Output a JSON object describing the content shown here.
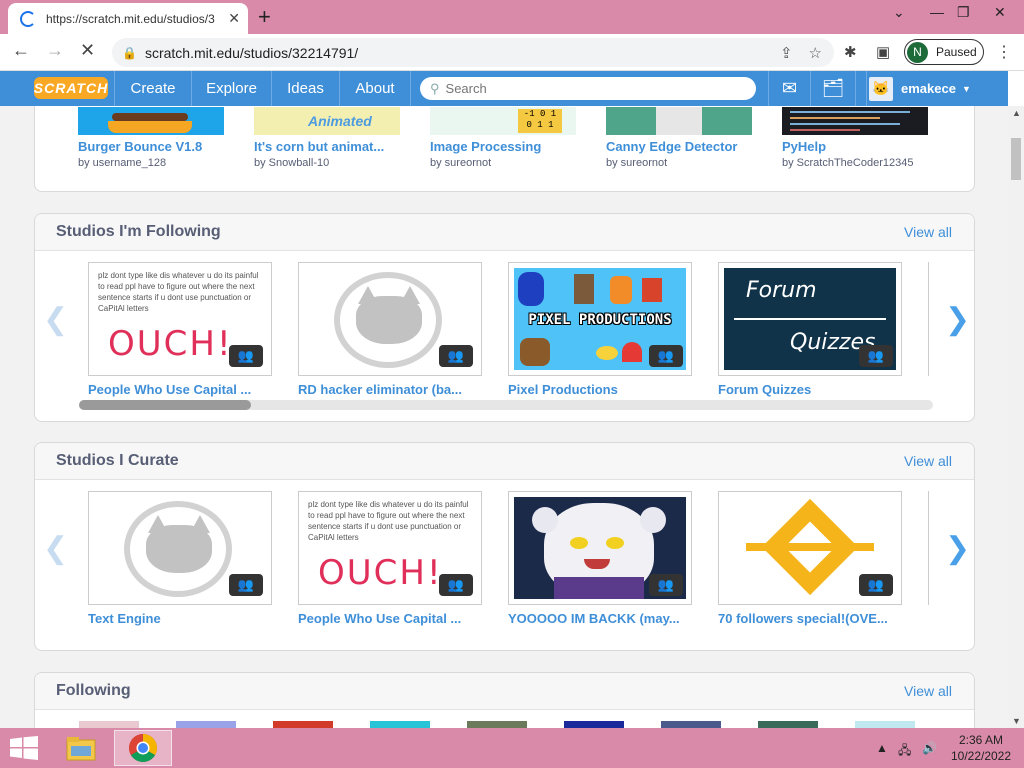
{
  "browser": {
    "tab_title": "https://scratch.mit.edu/studios/3",
    "new_tab": "+",
    "url": "scratch.mit.edu/studios/32214791/",
    "profile_initial": "N",
    "profile_status": "Paused"
  },
  "nav": {
    "logo": "SCRATCH",
    "links": [
      "Create",
      "Explore",
      "Ideas",
      "About"
    ],
    "search_placeholder": "Search",
    "username": "emakece"
  },
  "top_projects": [
    {
      "title": "Burger Bounce V1.8",
      "author": "by username_128"
    },
    {
      "title": "It's corn but animat...",
      "author": "by Snowball-10"
    },
    {
      "title": "Image Processing",
      "author": "by sureornot"
    },
    {
      "title": "Canny Edge Detector",
      "author": "by sureornot"
    },
    {
      "title": "PyHelp",
      "author": "by ScratchTheCoder12345"
    }
  ],
  "following_section": {
    "heading": "Studios I'm Following",
    "view_all": "View all",
    "studios": [
      {
        "title": "People Who Use Capital ...",
        "thumb_text": "plz dont type like dis whatever u do its painful to read ppl have to figure out where the next sentence starts if u dont use punctuation or CaPitAl letters",
        "thumb_big": "OUCH!"
      },
      {
        "title": "RD hacker eliminator (ba..."
      },
      {
        "title": "Pixel Productions",
        "thumb_big": "PIXEL PRODUCTIONS"
      },
      {
        "title": "Forum Quizzes",
        "thumb_big": "Forum",
        "thumb_big2": "Quizzes"
      }
    ]
  },
  "curate_section": {
    "heading": "Studios I Curate",
    "view_all": "View all",
    "studios": [
      {
        "title": "Text Engine"
      },
      {
        "title": "People Who Use Capital ...",
        "thumb_text": "plz dont type like dis whatever u do its painful to read ppl have to figure out where the next sentence starts if u dont use punctuation or CaPitAl letters",
        "thumb_big": "OUCH!"
      },
      {
        "title": "YOOOOO IM BACKK (may..."
      },
      {
        "title": "70 followers special!(OVE..."
      }
    ]
  },
  "following_users": {
    "heading": "Following",
    "view_all": "View all"
  },
  "taskbar": {
    "time": "2:36 AM",
    "date": "10/22/2022"
  }
}
